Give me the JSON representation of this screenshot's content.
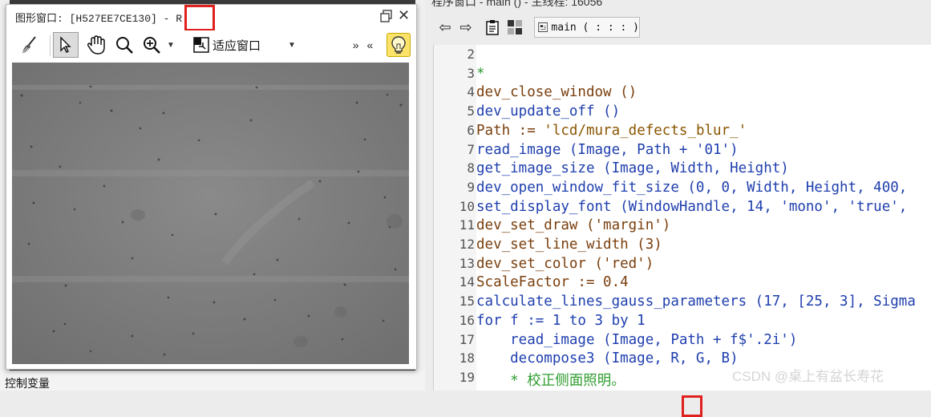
{
  "background": {
    "bottom_label": "控制变量"
  },
  "graphics_window": {
    "title": "图形窗口: [H527EE7CE130] -",
    "title_suffix": "R",
    "toolbar": {
      "fit_label": "适应窗口",
      "more_label": "» «"
    }
  },
  "program_window": {
    "topbar_text": "程序窗口 - main () - 主线程: 16056",
    "procedure_selector": "main ( : : : )",
    "lines": [
      {
        "num": "2",
        "segments": [
          {
            "t": "",
            "c": "plain"
          }
        ]
      },
      {
        "num": "3",
        "segments": [
          {
            "t": "*",
            "c": "cm"
          }
        ]
      },
      {
        "num": "4",
        "segments": [
          {
            "t": "dev_close_window ()",
            "c": "op"
          }
        ]
      },
      {
        "num": "5",
        "segments": [
          {
            "t": "dev_update_off ()",
            "c": "kw"
          }
        ]
      },
      {
        "num": "6",
        "segments": [
          {
            "t": "Path := ",
            "c": "op"
          },
          {
            "t": "'lcd/mura_defects_blur_'",
            "c": "str"
          }
        ]
      },
      {
        "num": "7",
        "segments": [
          {
            "t": "read_image (Image, Path + '01')",
            "c": "kw"
          }
        ]
      },
      {
        "num": "8",
        "segments": [
          {
            "t": "get_image_size (Image, Width, Height)",
            "c": "kw"
          }
        ]
      },
      {
        "num": "9",
        "segments": [
          {
            "t": "dev_open_window_fit_size (0, 0, Width, Height, 400,",
            "c": "kw"
          }
        ]
      },
      {
        "num": "10",
        "segments": [
          {
            "t": "set_display_font (WindowHandle, 14, 'mono', 'true',",
            "c": "kw"
          }
        ]
      },
      {
        "num": "11",
        "segments": [
          {
            "t": "dev_set_draw ('margin')",
            "c": "op"
          }
        ]
      },
      {
        "num": "12",
        "segments": [
          {
            "t": "dev_set_line_width (3)",
            "c": "op"
          }
        ]
      },
      {
        "num": "13",
        "segments": [
          {
            "t": "dev_set_color ('red')",
            "c": "op"
          }
        ]
      },
      {
        "num": "14",
        "segments": [
          {
            "t": "ScaleFactor := 0.4",
            "c": "op"
          }
        ]
      },
      {
        "num": "15",
        "segments": [
          {
            "t": "calculate_lines_gauss_parameters (17, [25, 3], Sigma",
            "c": "kw"
          }
        ]
      },
      {
        "num": "16",
        "segments": [
          {
            "t": "for f := 1 to 3 by 1",
            "c": "kw"
          }
        ]
      },
      {
        "num": "17",
        "segments": [
          {
            "t": "    read_image (Image, Path + f$'.2i')",
            "c": "kw"
          }
        ]
      },
      {
        "num": "18",
        "segments": [
          {
            "t": "    decompose3 (Image, R, G, B)",
            "c": "kw"
          }
        ]
      },
      {
        "num": "19",
        "segments": [
          {
            "t": "    * 校正侧面照明。",
            "c": "cm"
          }
        ]
      }
    ]
  },
  "watermark": "CSDN @桌上有盆长寿花",
  "colors": {
    "highlight_red": "#e0201c",
    "keyword_blue": "#1f3fae",
    "operator_brown": "#7a3e0c",
    "comment_green": "#2e9c2e",
    "bulb_yellow": "#fbe36a"
  }
}
